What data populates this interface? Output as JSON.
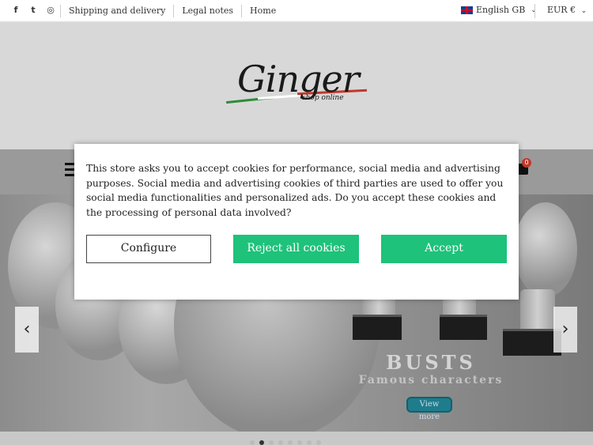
{
  "topbar": {
    "social": [
      {
        "icon": "facebook-icon",
        "glyph": "f"
      },
      {
        "icon": "twitter-icon",
        "glyph": "t"
      },
      {
        "icon": "instagram-icon",
        "glyph": "◎"
      }
    ],
    "links": [
      "Shipping and delivery",
      "Legal notes",
      "Home"
    ],
    "language": "English GB",
    "currency": "EUR €"
  },
  "logo": {
    "word": "Ginger",
    "subtitle": "shop online"
  },
  "cart": {
    "count": "0"
  },
  "hero": {
    "title": "BUSTS",
    "subtitle": "Famous characters",
    "button": "View more",
    "prev_arrow": "‹",
    "next_arrow": "›"
  },
  "cookie_modal": {
    "text": "This store asks you to accept cookies for performance, social media and advertising purposes. Social media and advertising cookies of third parties are used to offer you social media functionalities and personalized ads. Do you accept these cookies and the processing of personal data involved?",
    "configure_label": "Configure",
    "reject_label": "Reject all cookies",
    "accept_label": "Accept"
  },
  "colors": {
    "accent_green": "#1ec27a",
    "cart_badge": "#c0392b",
    "view_more": "#1f7c8c"
  }
}
